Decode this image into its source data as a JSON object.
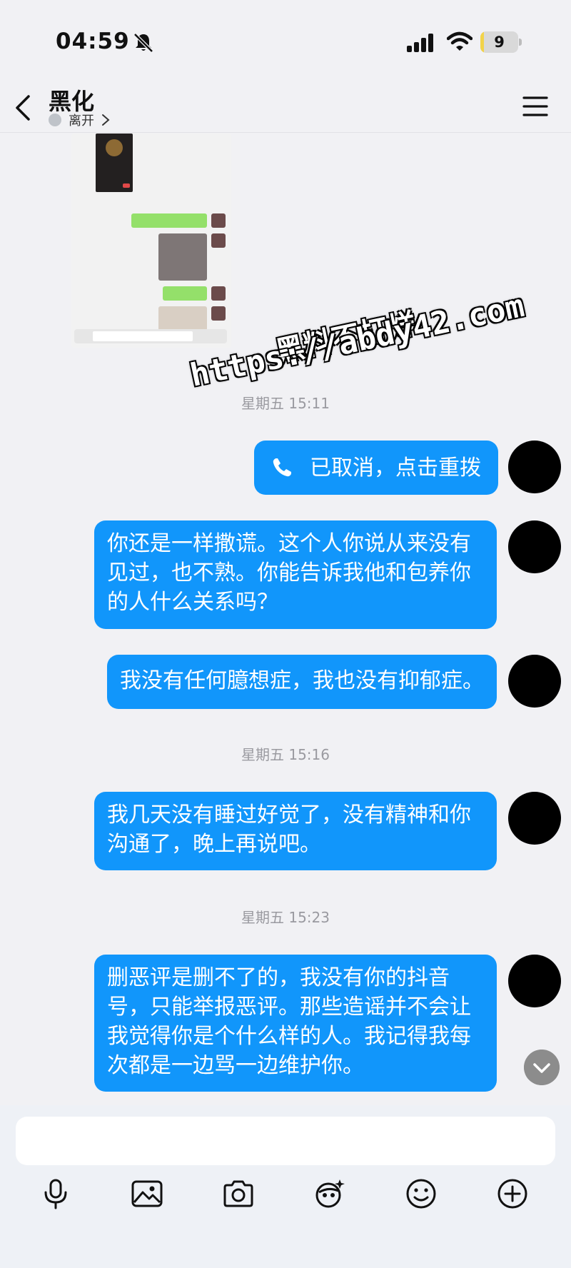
{
  "status_bar": {
    "time": "04:59",
    "battery_level": "9",
    "battery_fraction": 0.09
  },
  "header": {
    "contact_name": "黑化",
    "contact_status": "离开"
  },
  "messages": {
    "items": [
      {
        "type": "call",
        "text": "已取消，点击重拨"
      },
      {
        "type": "text",
        "text": "你还是一样撒谎。这个人你说从来没有见过，也不熟。你能告诉我他和包养你的人什么关系吗？"
      },
      {
        "type": "text",
        "text": "我没有任何臆想症，我也没有抑郁症。"
      },
      {
        "type": "text",
        "text": "我几天没有睡过好觉了，没有精神和你沟通了，晚上再说吧。"
      },
      {
        "type": "text",
        "text": "删恶评是删不了的，我没有你的抖音号，只能举报恶评。那些造谣并不会让我觉得你是个什么样的人。我记得我每次都是一边骂一边维护你。"
      }
    ],
    "timestamps": [
      "星期五 15:11",
      "星期五 15:16",
      "星期五 15:23"
    ]
  },
  "watermark": {
    "line1": "黑料不打烊",
    "line2": "https://abdy42.com"
  },
  "input": {
    "placeholder": ""
  },
  "toolbar": {
    "icons": [
      "microphone-icon",
      "image-icon",
      "camera-icon",
      "sticker-icon",
      "emoji-icon",
      "add-icon"
    ]
  },
  "colors": {
    "bubble": "#1196fb",
    "background": "#f1f1f4",
    "battery_fill": "#f2d34a"
  }
}
